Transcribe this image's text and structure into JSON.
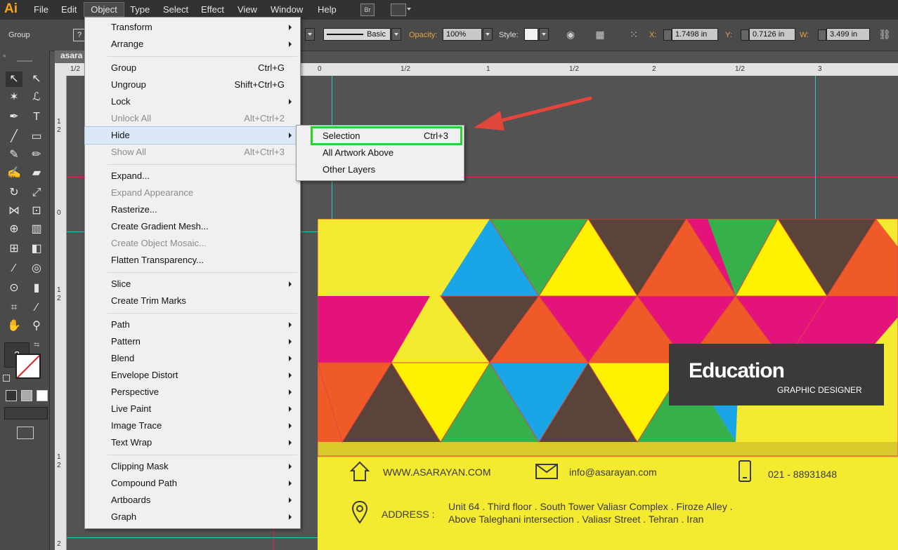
{
  "app": {
    "logo": "Ai"
  },
  "menubar": {
    "items": [
      "File",
      "Edit",
      "Object",
      "Type",
      "Select",
      "Effect",
      "View",
      "Window",
      "Help"
    ],
    "br_label": "Br"
  },
  "control_bar": {
    "selection_type": "Group",
    "help_badge": "?",
    "stroke_style": "Basic",
    "opacity_label": "Opacity:",
    "opacity_value": "100%",
    "style_label": "Style:",
    "x_label": "X:",
    "x_value": "1.7498 in",
    "y_label": "Y:",
    "y_value": "0.7126 in",
    "w_label": "W:",
    "w_value": "3.499 in"
  },
  "document": {
    "tab_label": "asara"
  },
  "rulers": {
    "h_ticks": [
      "1/2",
      "0",
      "1/2",
      "1",
      "1/2",
      "2",
      "1/2",
      "3"
    ],
    "v_ticks": [
      "1",
      "2",
      "0",
      "1",
      "2",
      "1",
      "2",
      "2"
    ]
  },
  "object_menu": {
    "items": [
      {
        "label": "Transform",
        "shortcut": "",
        "submenu": true,
        "disabled": false
      },
      {
        "label": "Arrange",
        "shortcut": "",
        "submenu": true,
        "disabled": false
      },
      {
        "label": "Group",
        "shortcut": "Ctrl+G",
        "submenu": false,
        "disabled": false
      },
      {
        "label": "Ungroup",
        "shortcut": "Shift+Ctrl+G",
        "submenu": false,
        "disabled": false
      },
      {
        "label": "Lock",
        "shortcut": "",
        "submenu": true,
        "disabled": false
      },
      {
        "label": "Unlock All",
        "shortcut": "Alt+Ctrl+2",
        "submenu": false,
        "disabled": true
      },
      {
        "label": "Hide",
        "shortcut": "",
        "submenu": true,
        "disabled": false,
        "highlighted": true
      },
      {
        "label": "Show All",
        "shortcut": "Alt+Ctrl+3",
        "submenu": false,
        "disabled": true
      },
      {
        "label": "Expand...",
        "shortcut": "",
        "submenu": false,
        "disabled": false
      },
      {
        "label": "Expand Appearance",
        "shortcut": "",
        "submenu": false,
        "disabled": true
      },
      {
        "label": "Rasterize...",
        "shortcut": "",
        "submenu": false,
        "disabled": false
      },
      {
        "label": "Create Gradient Mesh...",
        "shortcut": "",
        "submenu": false,
        "disabled": false
      },
      {
        "label": "Create Object Mosaic...",
        "shortcut": "",
        "submenu": false,
        "disabled": true
      },
      {
        "label": "Flatten Transparency...",
        "shortcut": "",
        "submenu": false,
        "disabled": false
      },
      {
        "label": "Slice",
        "shortcut": "",
        "submenu": true,
        "disabled": false
      },
      {
        "label": "Create Trim Marks",
        "shortcut": "",
        "submenu": false,
        "disabled": false
      },
      {
        "label": "Path",
        "shortcut": "",
        "submenu": true,
        "disabled": false
      },
      {
        "label": "Pattern",
        "shortcut": "",
        "submenu": true,
        "disabled": false
      },
      {
        "label": "Blend",
        "shortcut": "",
        "submenu": true,
        "disabled": false
      },
      {
        "label": "Envelope Distort",
        "shortcut": "",
        "submenu": true,
        "disabled": false
      },
      {
        "label": "Perspective",
        "shortcut": "",
        "submenu": true,
        "disabled": false
      },
      {
        "label": "Live Paint",
        "shortcut": "",
        "submenu": true,
        "disabled": false
      },
      {
        "label": "Image Trace",
        "shortcut": "",
        "submenu": true,
        "disabled": false
      },
      {
        "label": "Text Wrap",
        "shortcut": "",
        "submenu": true,
        "disabled": false
      },
      {
        "label": "Clipping Mask",
        "shortcut": "",
        "submenu": true,
        "disabled": false
      },
      {
        "label": "Compound Path",
        "shortcut": "",
        "submenu": true,
        "disabled": false
      },
      {
        "label": "Artboards",
        "shortcut": "",
        "submenu": true,
        "disabled": false
      },
      {
        "label": "Graph",
        "shortcut": "",
        "submenu": true,
        "disabled": false
      }
    ]
  },
  "hide_submenu": {
    "items": [
      {
        "label": "Selection",
        "shortcut": "Ctrl+3"
      },
      {
        "label": "All Artwork Above",
        "shortcut": ""
      },
      {
        "label": "Other Layers",
        "shortcut": ""
      }
    ]
  },
  "card": {
    "title": "Education",
    "subtitle": "GRAPHIC DESIGNER",
    "website": "WWW.ASARAYAN.COM",
    "email": "info@asarayan.com",
    "phone": "021 - 88931848",
    "address_label": "ADDRESS :",
    "address_line1": "Unit 64 . Third floor . South Tower Valiasr Complex . Firoze Alley .",
    "address_line2": "Above Taleghani intersection . Valiasr Street .  Tehran . Iran"
  },
  "colors": {
    "accent_highlight": "#2fd02f",
    "annotation_arrow": "#e0463a",
    "card_yellow": "#f4ea2f",
    "magenta": "#e4137b",
    "green": "#35b04a",
    "cyan": "#1aa6e6",
    "orange": "#f05a28",
    "brown": "#5a4339",
    "guide": "#27c8c8"
  }
}
